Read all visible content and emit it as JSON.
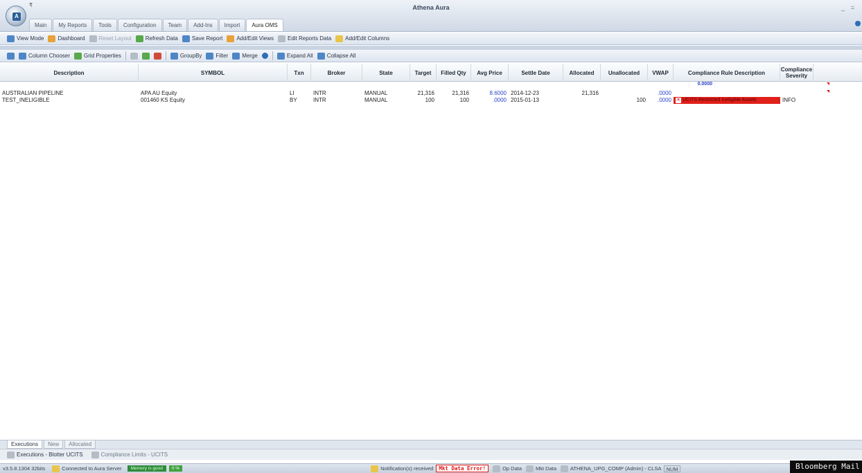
{
  "window": {
    "title": "Athena Aura",
    "qat_glyph": "₹",
    "controls": "_ ="
  },
  "ribbon_tabs": [
    "Main",
    "My Reports",
    "Tools",
    "Configuration",
    "Team",
    "Add-Ins",
    "Import",
    "Aura OMS"
  ],
  "toolbar1": {
    "view_mode": "View Mode",
    "dashboard": "Dashboard",
    "reset_layout": "Reset Layout",
    "refresh_data": "Refresh Data",
    "save_report": "Save Report",
    "add_edit_views": "Add/Edit Views",
    "edit_reports_data": "Edit Reports Data",
    "add_edit_columns": "Add/Edit Columns"
  },
  "toolbar2": {
    "column_chooser": "Column Chooser",
    "grid_properties": "Grid Properties",
    "groupby": "GroupBy",
    "filter": "Filter",
    "merge": "Merge",
    "expand_all": "Expand All",
    "collapse_all": "Collapse All"
  },
  "grid": {
    "columns": [
      "Description",
      "SYMBOL",
      "Txn",
      "Broker",
      "State",
      "Target",
      "Filled Qty",
      "Avg Price",
      "Settle Date",
      "Allocated",
      "Unallocated",
      "VWAP",
      "Compliance Rule Description",
      "Compliance Severity"
    ],
    "summary_vwap": "0.0000",
    "rows": [
      {
        "description": "AUSTRALIAN PIPELINE",
        "symbol": "APA AU Equity",
        "txn": "LI",
        "broker": "INTR",
        "state": "MANUAL",
        "target": "21,316",
        "filled_qty": "21,316",
        "avg_price": "8.6000",
        "settle_date": "2014-12-23",
        "allocated": "21,316",
        "unallocated": "",
        "vwap": ".0000",
        "compliance_rule": "",
        "compliance_severity": ""
      },
      {
        "description": "TEST_INELIGIBLE",
        "symbol": "001460 KS Equity",
        "txn": "BY",
        "broker": "INTR",
        "state": "MANUAL",
        "target": "100",
        "filled_qty": "100",
        "avg_price": ".0000",
        "settle_date": "2015-01-13",
        "allocated": "",
        "unallocated": "100",
        "vwap": ".0000",
        "compliance_rule": "UCITS Restricted Ineligible Assets",
        "compliance_severity": "INFO"
      }
    ]
  },
  "sheet_tabs": [
    "Executions",
    "New",
    "Allocated"
  ],
  "page_tabs": [
    "Executions - Blotter UCITS",
    "Compliance Limits - UCITS"
  ],
  "statusbar": {
    "version": "v3.5.8.1304 32bits",
    "connection": "Connected to Aura Server",
    "memory": "Memory is good",
    "cpu": "0 %",
    "notifications": "Notification(s) received",
    "mkt_data_error": "Mkt Data Error!",
    "op_data": "Op Data",
    "mkt_data": "Mkt Data",
    "user": "ATHENA_UPG_COMP (Admin) - CLSA",
    "num": "NUM",
    "bloomberg_mail": "Bloomberg Mail"
  }
}
